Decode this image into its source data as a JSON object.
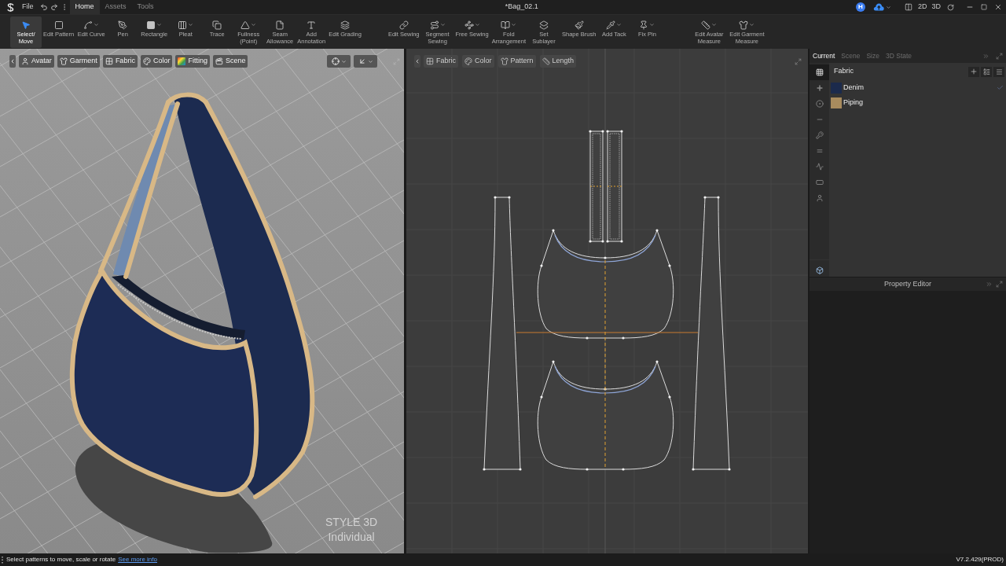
{
  "title_bar": {
    "file_menu": "File",
    "tabs": [
      {
        "label": "Home",
        "selected": true
      },
      {
        "label": "Assets",
        "selected": false
      },
      {
        "label": "Tools",
        "selected": false
      }
    ],
    "document_title": "*Bag_02.1",
    "account_initial": "H",
    "view_modes": [
      "2D",
      "3D"
    ]
  },
  "toolbar": {
    "groups": [
      [
        {
          "label": "Select/\nMove",
          "selected": true,
          "dropdown": false
        },
        {
          "label": "Edit Pattern",
          "selected": false,
          "dropdown": false
        },
        {
          "label": "Edit Curve",
          "selected": false,
          "dropdown": true
        },
        {
          "label": "Pen",
          "selected": false,
          "dropdown": false
        },
        {
          "label": "Rectangle",
          "selected": false,
          "dropdown": true
        },
        {
          "label": "Pleat",
          "selected": false,
          "dropdown": true
        },
        {
          "label": "Trace",
          "selected": false,
          "dropdown": false
        },
        {
          "label": "Fullness\n(Point)",
          "selected": false,
          "dropdown": true
        },
        {
          "label": "Seam\nAllowance",
          "selected": false,
          "dropdown": false
        },
        {
          "label": "Add\nAnnotation",
          "selected": false,
          "dropdown": false
        },
        {
          "label": "Edit Grading",
          "selected": false,
          "dropdown": false
        }
      ],
      [
        {
          "label": "Edit Sewing",
          "selected": false,
          "dropdown": false
        },
        {
          "label": "Segment\nSewing",
          "selected": false,
          "dropdown": true
        },
        {
          "label": "Free Sewing",
          "selected": false,
          "dropdown": true
        },
        {
          "label": "Fold\nArrangement",
          "selected": false,
          "dropdown": true
        },
        {
          "label": "Set\nSublayer",
          "selected": false,
          "dropdown": false
        },
        {
          "label": "Shape Brush",
          "selected": false,
          "dropdown": false
        },
        {
          "label": "Add Tack",
          "selected": false,
          "dropdown": true
        },
        {
          "label": "Fix Pin",
          "selected": false,
          "dropdown": true
        }
      ],
      [
        {
          "label": "Edit Avatar\nMeasure",
          "selected": false,
          "dropdown": true
        },
        {
          "label": "Edit Garment\nMeasure",
          "selected": false,
          "dropdown": true
        }
      ]
    ]
  },
  "viewport_3d": {
    "buttons": [
      {
        "label": "Avatar"
      },
      {
        "label": "Garment"
      },
      {
        "label": "Fabric"
      },
      {
        "label": "Color"
      },
      {
        "label": "Fitting"
      },
      {
        "label": "Scene"
      }
    ],
    "edition_label": "STYLE 3D\nIndividual"
  },
  "viewport_2d": {
    "buttons": [
      {
        "label": "Fabric"
      },
      {
        "label": "Color"
      },
      {
        "label": "Pattern"
      },
      {
        "label": "Length"
      }
    ]
  },
  "right_panel": {
    "tabs": [
      {
        "label": "Current",
        "selected": true
      },
      {
        "label": "Scene",
        "selected": false
      },
      {
        "label": "Size",
        "selected": false
      },
      {
        "label": "3D State",
        "selected": false
      }
    ],
    "side_tabs": [
      {
        "kind": "fabric",
        "selected": true
      },
      {
        "kind": "button",
        "selected": false
      },
      {
        "kind": "buttonhole",
        "selected": false
      },
      {
        "kind": "pin",
        "selected": false
      },
      {
        "kind": "zipper",
        "selected": false
      },
      {
        "kind": "topstitch",
        "selected": false
      },
      {
        "kind": "puckering",
        "selected": false
      },
      {
        "kind": "tape",
        "selected": false
      },
      {
        "kind": "trim",
        "selected": false
      }
    ],
    "library": {
      "title": "Fabric",
      "items": [
        {
          "name": "Denim",
          "color": "#1b2a4c",
          "checked": true
        },
        {
          "name": "Piping",
          "color": "#a88b5e",
          "checked": false
        }
      ]
    },
    "property_editor": {
      "title": "Property Editor"
    }
  },
  "status_bar": {
    "message": "Select patterns to move, scale or rotate",
    "link": "See more info",
    "version": "V7.2.429(PROD)"
  }
}
